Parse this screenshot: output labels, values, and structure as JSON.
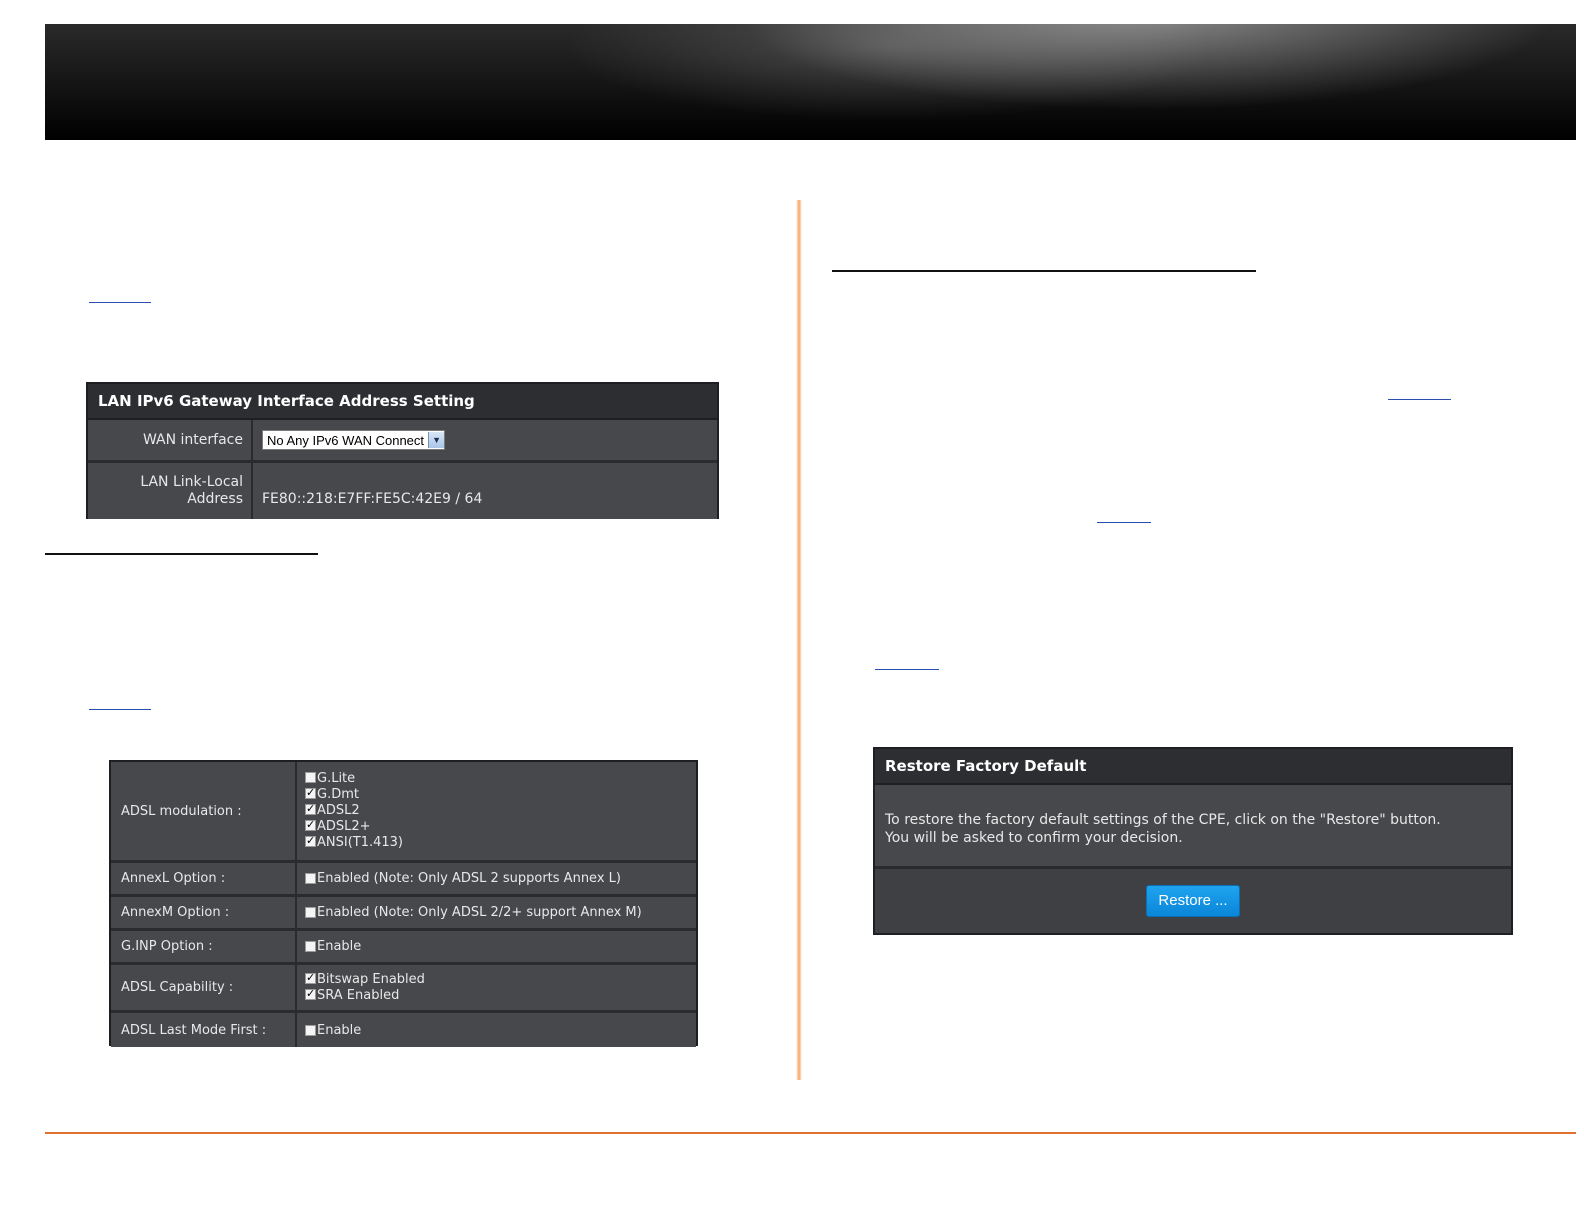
{
  "lan_ipv6_panel": {
    "title": "LAN IPv6 Gateway Interface Address Setting",
    "wan_interface_label": "WAN interface",
    "wan_interface_value": "No Any IPv6 WAN Connect",
    "link_local_label_line1": "LAN Link-Local",
    "link_local_label_line2": "Address",
    "link_local_value": "FE80::218:E7FF:FE5C:42E9 / 64"
  },
  "adsl_panel": {
    "modulation_label": "ADSL modulation  :",
    "modulation_options": [
      {
        "label": "G.Lite",
        "checked": false
      },
      {
        "label": "G.Dmt",
        "checked": true
      },
      {
        "label": "ADSL2",
        "checked": true
      },
      {
        "label": "ADSL2+",
        "checked": true
      },
      {
        "label": "ANSI(T1.413)",
        "checked": true
      }
    ],
    "annexl_label": "AnnexL Option  :",
    "annexl_value": " Enabled (Note: Only ADSL 2 supports Annex L)",
    "annexm_label": "AnnexM Option  :",
    "annexm_value": "Enabled (Note: Only ADSL 2/2+ support Annex M)",
    "ginp_label": "G.INP Option  :",
    "ginp_value": "Enable",
    "capability_label": "ADSL Capability  :",
    "capability_bitswap": "Bitswap Enabled",
    "capability_sra": "SRA Enabled",
    "lastmode_label": "ADSL Last Mode First  :",
    "lastmode_value": "Enable"
  },
  "restore_panel": {
    "title": "Restore Factory Default",
    "description_line1": "To restore the factory default settings of the CPE, click on the \"Restore\" button.",
    "description_line2": "You will be asked to confirm your decision.",
    "button_label": "Restore ..."
  },
  "colors": {
    "accent_orange": "#e07030",
    "button_blue": "#0b86d8",
    "panel_bg": "#46484c"
  }
}
